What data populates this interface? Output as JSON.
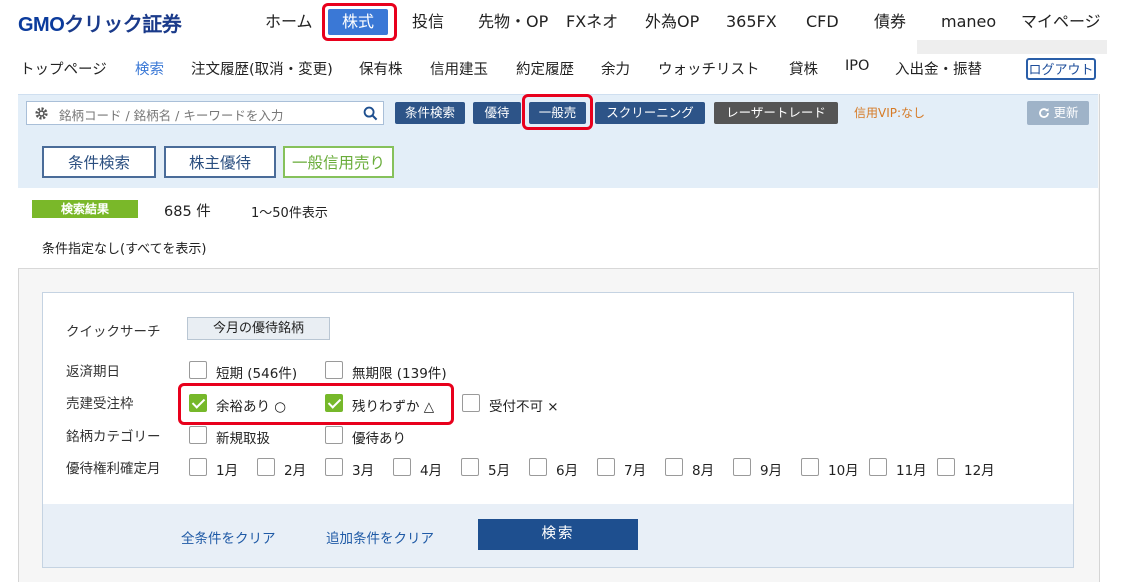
{
  "header": {
    "logo": {
      "brand": "GMO",
      "rest": "クリック証券"
    },
    "nav": [
      "ホーム",
      "株式",
      "投信",
      "先物・OP",
      "FXネオ",
      "外為OP",
      "365FX",
      "CFD",
      "債券",
      "maneo",
      "マイページ"
    ],
    "active_nav": "株式"
  },
  "subnav": {
    "items": [
      "トップページ",
      "検索",
      "注文履歴(取消・変更)",
      "保有株",
      "信用建玉",
      "約定履歴",
      "余力",
      "ウォッチリスト",
      "貸株",
      "IPO",
      "入出金・振替"
    ],
    "active": "検索",
    "logout": "ログアウト"
  },
  "search_bar": {
    "placeholder": "銘柄コード / 銘柄名 / キーワードを入力",
    "buttons": [
      "条件検索",
      "優待",
      "一般売",
      "スクリーニング",
      "レーザートレード"
    ],
    "vip_text": "信用VIP:なし",
    "refresh": "更新"
  },
  "tabs": [
    "条件検索",
    "株主優待",
    "一般信用売り"
  ],
  "results": {
    "badge": "検索結果",
    "count": "685 件",
    "range": "1〜50件表示",
    "condition_text": "条件指定なし(すべてを表示)"
  },
  "criteria": {
    "quick_search_label": "クイックサーチ",
    "quick_search_button": "今月の優待銘柄",
    "repayment": {
      "label": "返済期日",
      "options": [
        {
          "text": "短期 (546件)",
          "checked": false
        },
        {
          "text": "無期限 (139件)",
          "checked": false
        }
      ]
    },
    "sell_quota": {
      "label": "売建受注枠",
      "options": [
        {
          "text": "余裕あり ○",
          "checked": true
        },
        {
          "text": "残りわずか △",
          "checked": true
        },
        {
          "text": "受付不可 ×",
          "checked": false
        }
      ]
    },
    "category": {
      "label": "銘柄カテゴリー",
      "options": [
        {
          "text": "新規取扱",
          "checked": false
        },
        {
          "text": "優待あり",
          "checked": false
        }
      ]
    },
    "months": {
      "label": "優待権利確定月",
      "options": [
        "1月",
        "2月",
        "3月",
        "4月",
        "5月",
        "6月",
        "7月",
        "8月",
        "9月",
        "10月",
        "11月",
        "12月"
      ]
    },
    "clear_all": "全条件をクリア",
    "clear_extra": "追加条件をクリア",
    "search_button": "検索"
  },
  "colors": {
    "accent_red": "#e8001c",
    "navy": "#1e4f8f",
    "green": "#76b82a",
    "link_blue": "#3a78d6"
  }
}
